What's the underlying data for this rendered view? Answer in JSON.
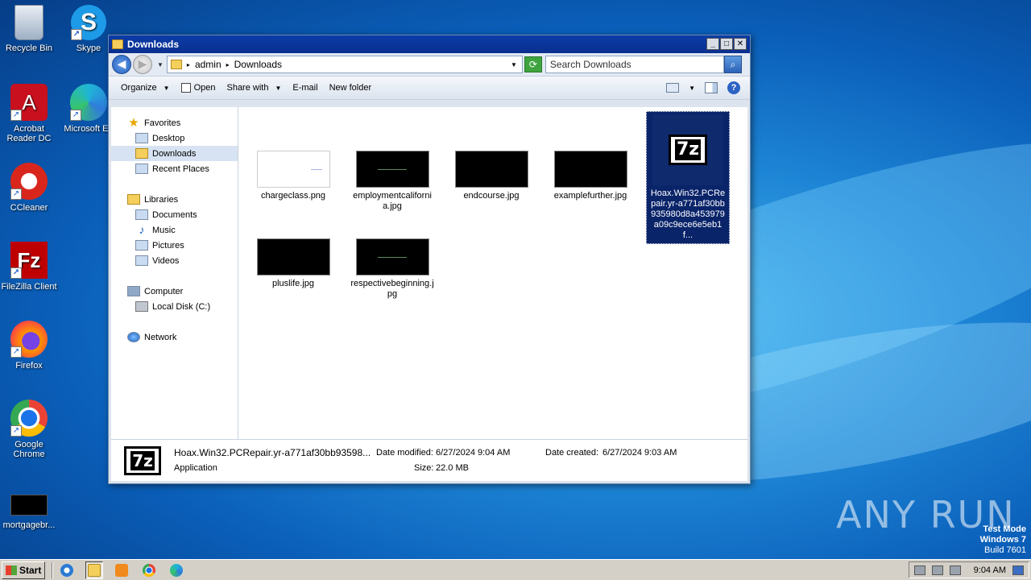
{
  "desktop": {
    "icons": [
      {
        "label": "Recycle Bin"
      },
      {
        "label": "Skype"
      },
      {
        "label": "Acrobat Reader DC"
      },
      {
        "label": "Microsoft Ed"
      },
      {
        "label": "CCleaner"
      },
      {
        "label": "FileZilla Client"
      },
      {
        "label": "Firefox"
      },
      {
        "label": "Google Chrome"
      },
      {
        "label": "mortgagebr..."
      }
    ]
  },
  "window": {
    "title": "Downloads",
    "controls": {
      "minimize": "_",
      "maximize": "□",
      "close": "✕"
    },
    "address": {
      "crumbs": [
        "admin",
        "Downloads"
      ]
    },
    "search": {
      "placeholder": "Search Downloads"
    },
    "toolbar": {
      "organize": "Organize",
      "open": "Open",
      "share_with": "Share with",
      "email": "E-mail",
      "new_folder": "New folder"
    },
    "nav": {
      "favorites": "Favorites",
      "desktop": "Desktop",
      "downloads": "Downloads",
      "recent_places": "Recent Places",
      "libraries": "Libraries",
      "documents": "Documents",
      "music": "Music",
      "pictures": "Pictures",
      "videos": "Videos",
      "computer": "Computer",
      "local_disk": "Local Disk (C:)",
      "network": "Network"
    },
    "files": [
      {
        "name": "chargeclass.png"
      },
      {
        "name": "employmentcalifornia.jpg"
      },
      {
        "name": "endcourse.jpg"
      },
      {
        "name": "examplefurther.jpg"
      },
      {
        "name": "Hoax.Win32.PCRepair.yr-a771af30bb935980d8a453979a09c9ece6e5eb1f..."
      },
      {
        "name": "pluslife.jpg"
      },
      {
        "name": "respectivebeginning.jpg"
      }
    ],
    "details": {
      "name": "Hoax.Win32.PCRepair.yr-a771af30bb93598...",
      "type": "Application",
      "date_modified_label": "Date modified:",
      "date_modified": "6/27/2024 9:04 AM",
      "size_label": "Size:",
      "size": "22.0 MB",
      "date_created_label": "Date created:",
      "date_created": "6/27/2024 9:03 AM"
    }
  },
  "taskbar": {
    "start": "Start",
    "clock": "9:04 AM"
  },
  "watermark": {
    "line1": "Test Mode",
    "line2": "Windows 7",
    "line3": "Build 7601",
    "brand": "ANY RUN"
  }
}
